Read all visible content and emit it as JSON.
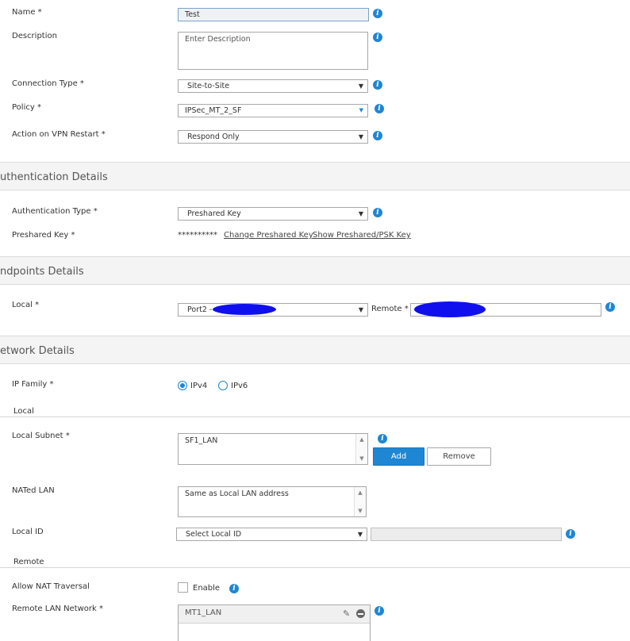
{
  "general": {
    "name_label": "Name *",
    "name_value": "Test",
    "description_label": "Description",
    "description_placeholder": "Enter Description",
    "connection_type_label": "Connection Type *",
    "connection_type_value": "Site-to-Site",
    "policy_label": "Policy *",
    "policy_value": "IPSec_MT_2_SF",
    "action_label": "Action on VPN Restart *",
    "action_value": "Respond Only"
  },
  "authentication": {
    "section_title": "uthentication Details",
    "type_label": "Authentication Type *",
    "type_value": "Preshared Key",
    "key_label": "Preshared Key *",
    "key_masked": "**********",
    "change_link": "Change Preshared Key",
    "show_link": "Show Preshared/PSK Key"
  },
  "endpoints": {
    "section_title": "ndpoints Details",
    "local_label": "Local *",
    "local_value": "Port2 -",
    "remote_label": "Remote *"
  },
  "network": {
    "section_title": "etwork Details",
    "ip_family_label": "IP Family *",
    "ipv4_label": "IPv4",
    "ipv6_label": "IPv6",
    "ip_family_selected": "IPv4",
    "local_sub_title": "Local",
    "local_subnet_label": "Local Subnet *",
    "local_subnet_value": "SF1_LAN",
    "add_button": "Add",
    "remove_button": "Remove",
    "nated_lan_label": "NATed LAN",
    "nated_lan_value": "Same as Local LAN address",
    "local_id_label": "Local ID",
    "local_id_value": "Select Local ID",
    "remote_sub_title": "Remote",
    "nat_traversal_label": "Allow NAT Traversal",
    "nat_traversal_enable": "Enable",
    "remote_lan_label": "Remote LAN Network *",
    "remote_lan_value": "MT1_LAN"
  },
  "icons": {
    "info": "info-icon",
    "dropdown": "chevron-down-icon",
    "edit": "pencil-icon",
    "remove": "minus-circle-icon"
  },
  "colors": {
    "accent": "#1f86d3",
    "redaction": "#1010ee"
  }
}
